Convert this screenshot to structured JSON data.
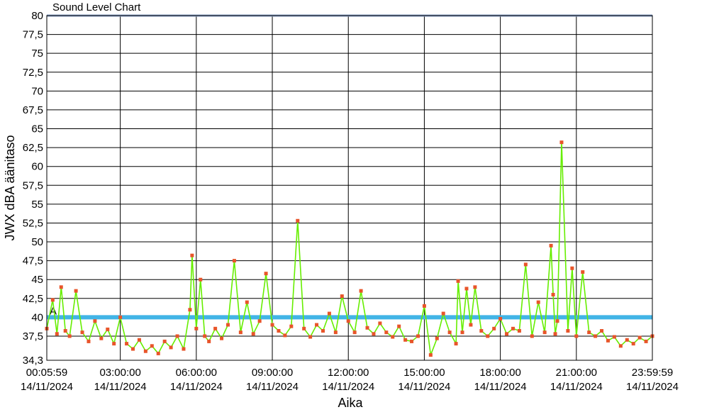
{
  "chart_data": {
    "type": "line",
    "title": "Sound Level Chart",
    "xlabel": "Aika",
    "ylabel": "JWX dBA äänitaso",
    "xlim": [
      "14/11/2024 00:05:59",
      "14/11/2024 23:59:59"
    ],
    "ylim": [
      34.3,
      80
    ],
    "grid": true,
    "y_ticks": [
      "34,3",
      "37,5",
      "40",
      "42,5",
      "45",
      "47,5",
      "50",
      "52,5",
      "55",
      "57,5",
      "60",
      "62,5",
      "65",
      "67,5",
      "70",
      "72,5",
      "75",
      "77,5",
      "80"
    ],
    "x_ticks": [
      {
        "time": "00:05:59",
        "date": "14/11/2024"
      },
      {
        "time": "03:00:00",
        "date": "14/11/2024"
      },
      {
        "time": "06:00:00",
        "date": "14/11/2024"
      },
      {
        "time": "09:00:00",
        "date": "14/11/2024"
      },
      {
        "time": "12:00:00",
        "date": "14/11/2024"
      },
      {
        "time": "15:00:00",
        "date": "14/11/2024"
      },
      {
        "time": "18:00:00",
        "date": "14/11/2024"
      },
      {
        "time": "21:00:00",
        "date": "14/11/2024"
      },
      {
        "time": "23:59:59",
        "date": "14/11/2024"
      }
    ],
    "threshold": {
      "label": "A",
      "value": 40,
      "color": "#42b4e6"
    },
    "series_color": "#66ee00",
    "marker_color": "#e8552a",
    "series": [
      {
        "x": [
          "00:05:59",
          "00:20",
          "00:30",
          "00:40",
          "00:50",
          "01:00",
          "01:15",
          "01:30",
          "01:45",
          "02:00",
          "02:15",
          "02:30",
          "02:45",
          "03:00",
          "03:15",
          "03:30",
          "03:45",
          "04:00",
          "04:15",
          "04:30",
          "04:45",
          "05:00",
          "05:15",
          "05:30",
          "05:45",
          "05:50",
          "06:00",
          "06:10",
          "06:20",
          "06:30",
          "06:45",
          "07:00",
          "07:15",
          "07:30",
          "07:45",
          "08:00",
          "08:15",
          "08:30",
          "08:45",
          "09:00",
          "09:15",
          "09:30",
          "09:45",
          "10:00",
          "10:15",
          "10:30",
          "10:45",
          "11:00",
          "11:15",
          "11:30",
          "11:45",
          "12:00",
          "12:15",
          "12:30",
          "12:45",
          "13:00",
          "13:15",
          "13:30",
          "13:45",
          "14:00",
          "14:15",
          "14:30",
          "14:45",
          "15:00",
          "15:15",
          "15:30",
          "15:45",
          "16:00",
          "16:15",
          "16:20",
          "16:30",
          "16:40",
          "16:50",
          "17:00",
          "17:15",
          "17:30",
          "17:45",
          "18:00",
          "18:15",
          "18:30",
          "18:45",
          "19:00",
          "19:15",
          "19:30",
          "19:45",
          "20:00",
          "20:05",
          "20:10",
          "20:15",
          "20:25",
          "20:40",
          "20:50",
          "21:00",
          "21:15",
          "21:30",
          "21:45",
          "22:00",
          "22:15",
          "22:30",
          "22:45",
          "23:00",
          "23:15",
          "23:30",
          "23:45",
          "23:59:59"
        ],
        "values": [
          38.5,
          42.3,
          37.8,
          44.0,
          38.2,
          37.5,
          43.5,
          38.0,
          36.8,
          39.5,
          37.2,
          38.4,
          36.5,
          40.0,
          36.5,
          35.8,
          37.0,
          35.5,
          36.2,
          35.2,
          36.8,
          36.0,
          37.5,
          35.8,
          41.0,
          48.2,
          38.5,
          45.0,
          37.5,
          36.8,
          38.5,
          37.2,
          39.0,
          47.5,
          38.0,
          42.0,
          37.8,
          39.5,
          45.8,
          39.0,
          38.2,
          37.6,
          38.8,
          52.8,
          38.5,
          37.4,
          39.0,
          38.2,
          40.5,
          38.0,
          42.8,
          39.5,
          38.0,
          43.5,
          38.6,
          37.8,
          39.2,
          38.0,
          37.4,
          38.8,
          37.0,
          36.8,
          37.5,
          41.5,
          35.0,
          37.2,
          40.5,
          38.0,
          36.5,
          44.8,
          38.0,
          43.8,
          39.0,
          44.0,
          38.2,
          37.5,
          38.5,
          39.8,
          37.8,
          38.5,
          38.2,
          47.0,
          37.5,
          42.0,
          38.0,
          49.5,
          43.0,
          37.8,
          39.5,
          63.2,
          38.2,
          46.5,
          37.5,
          46.0,
          38.0,
          37.5,
          38.2,
          36.9,
          37.4,
          36.2,
          37.0,
          36.5,
          37.3,
          36.8,
          37.5
        ]
      }
    ]
  }
}
